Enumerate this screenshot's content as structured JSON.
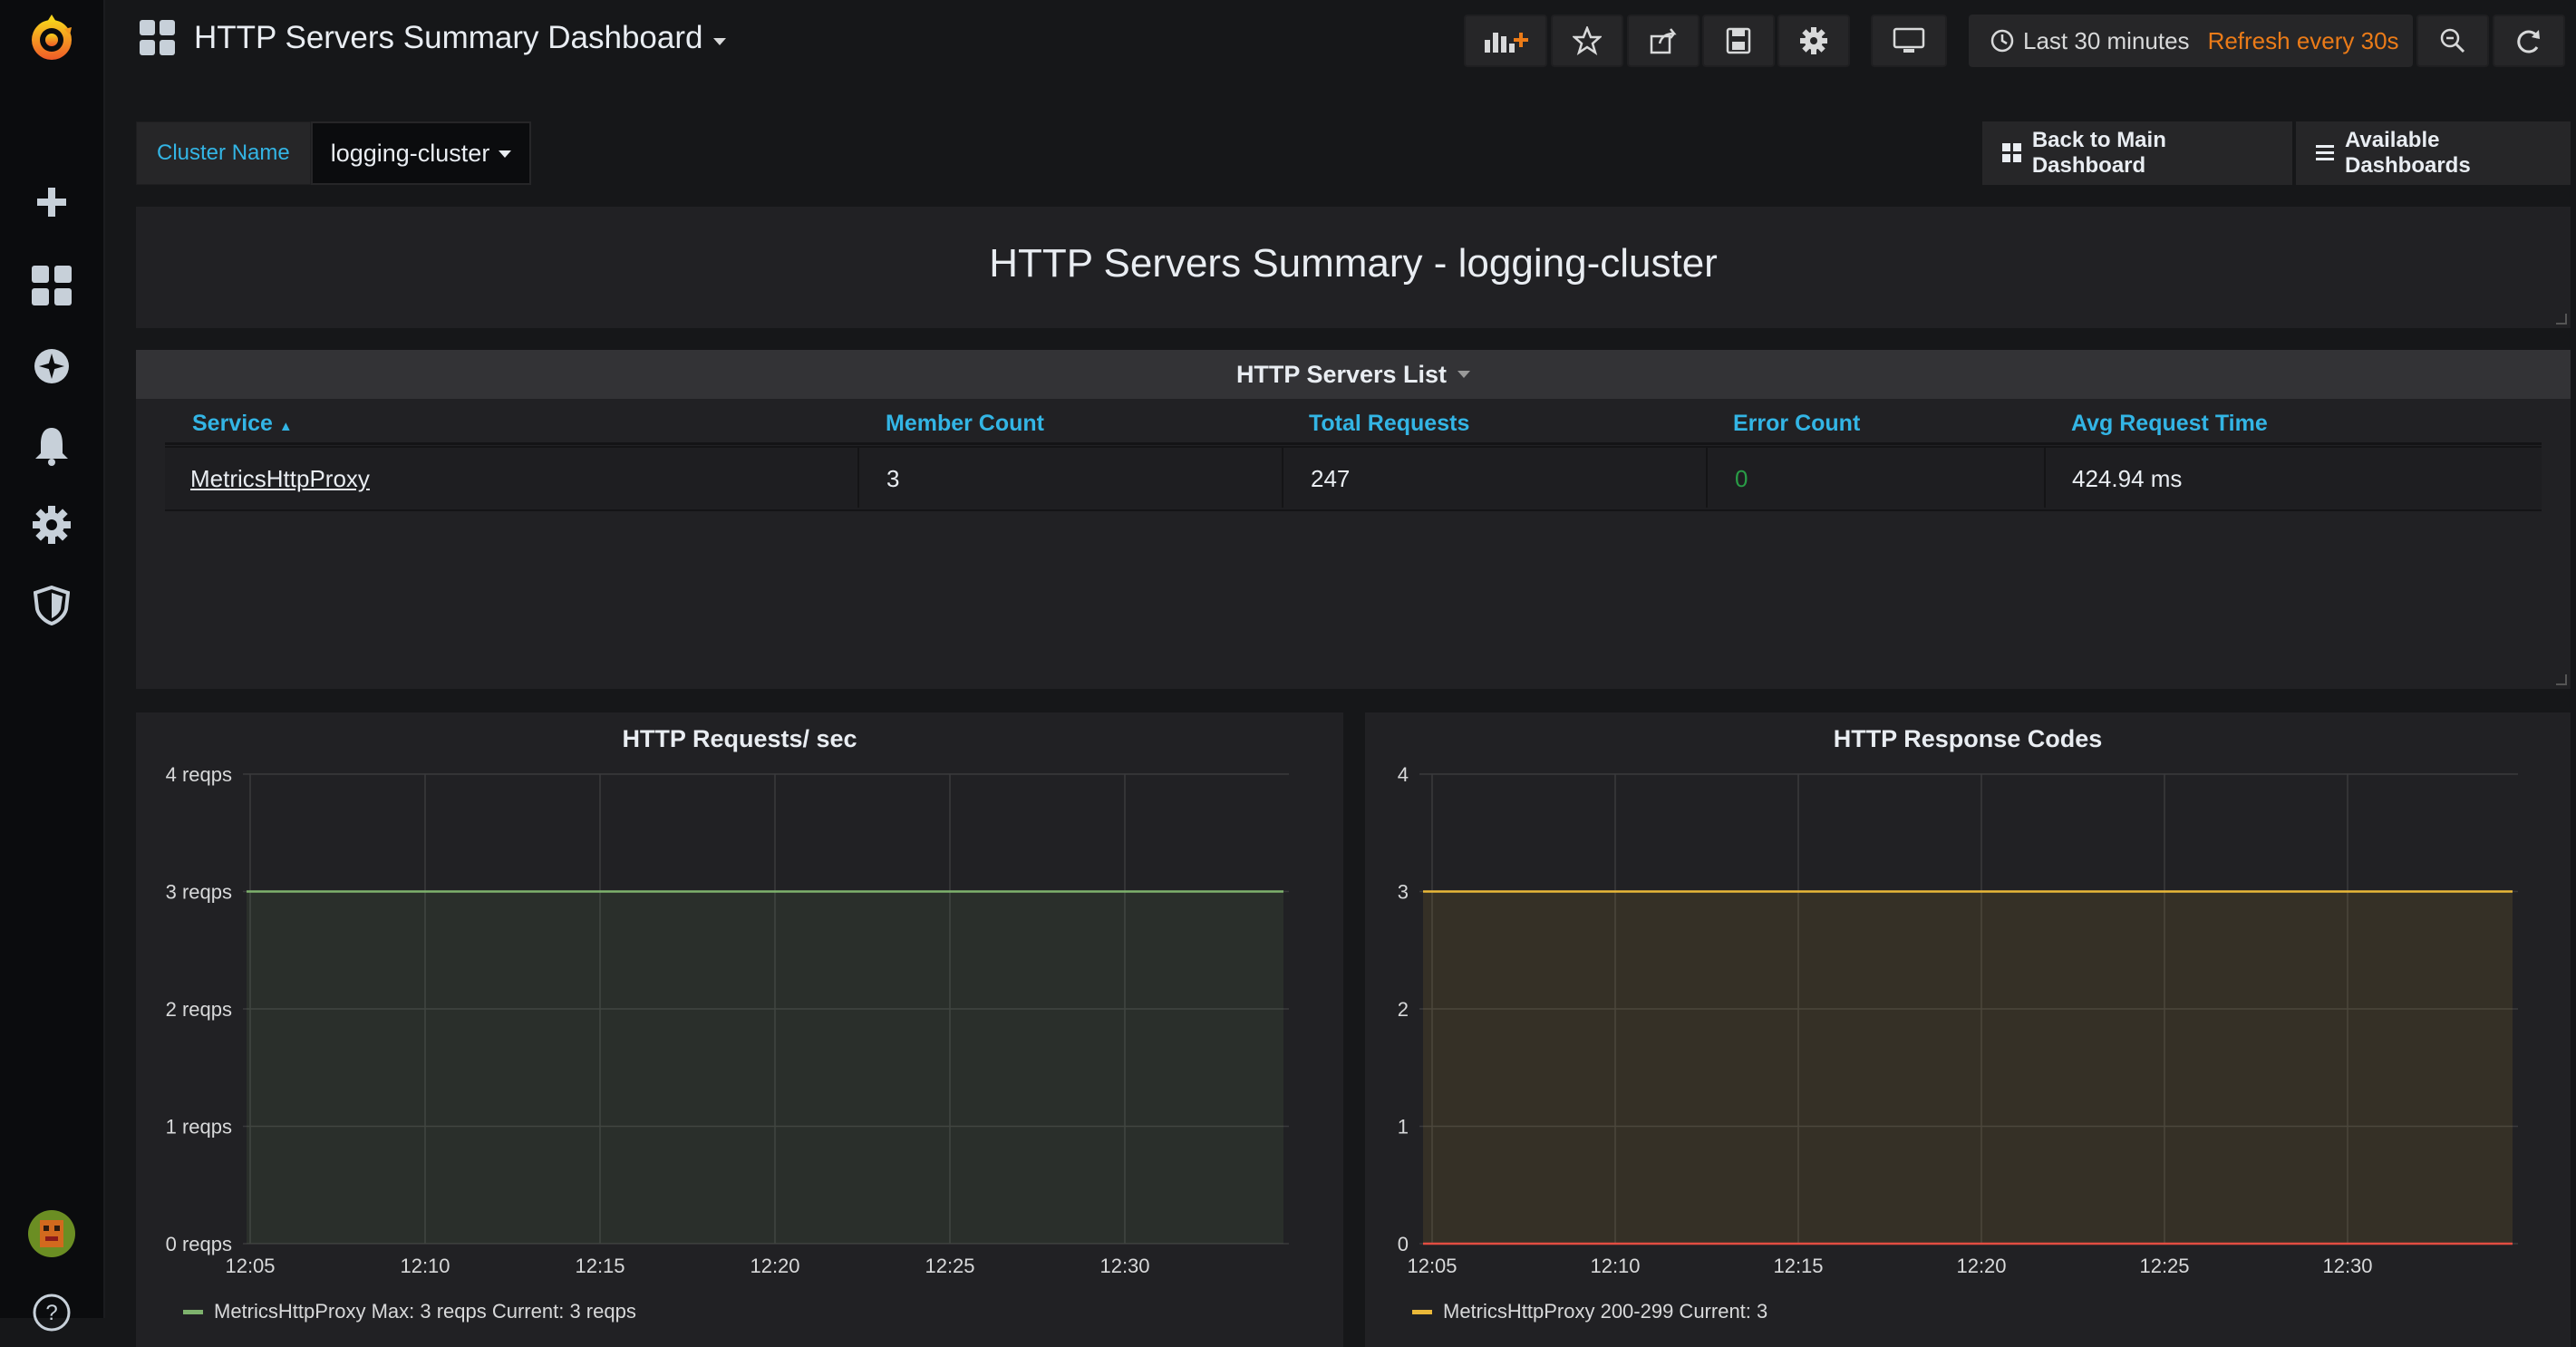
{
  "dashboard": {
    "title": "HTTP Servers Summary Dashboard"
  },
  "time_picker": {
    "range": "Last 30 minutes",
    "refresh": "Refresh every 30s"
  },
  "variables": {
    "cluster_label": "Cluster Name",
    "cluster_value": "logging-cluster"
  },
  "links": {
    "back": "Back to Main Dashboard",
    "available": "Available Dashboards"
  },
  "text_panel": {
    "title": "HTTP Servers Summary - logging-cluster"
  },
  "table": {
    "title": "HTTP Servers List",
    "columns": [
      "Service",
      "Member Count",
      "Total Requests",
      "Error Count",
      "Avg Request Time"
    ],
    "rows": [
      {
        "service": "MetricsHttpProxy",
        "member_count": "3",
        "total_requests": "247",
        "error_count": "0",
        "avg_request_time": "424.94 ms"
      }
    ]
  },
  "chart_data": [
    {
      "type": "area",
      "title": "HTTP Requests/ sec",
      "x": [
        "12:05",
        "12:10",
        "12:15",
        "12:20",
        "12:25",
        "12:30"
      ],
      "y_ticks": [
        "0 reqps",
        "1 reqps",
        "2 reqps",
        "3 reqps",
        "4 reqps"
      ],
      "ylim": [
        0,
        4
      ],
      "series": [
        {
          "name": "MetricsHttpProxy",
          "color": "#7eb26d",
          "values": [
            3,
            3,
            3,
            3,
            3,
            3
          ]
        }
      ],
      "legend": "MetricsHttpProxy  Max: 3 reqps  Current: 3 reqps",
      "grid": true
    },
    {
      "type": "area",
      "title": "HTTP Response Codes",
      "x": [
        "12:05",
        "12:10",
        "12:15",
        "12:20",
        "12:25",
        "12:30"
      ],
      "y_ticks": [
        "0",
        "1",
        "2",
        "3",
        "4"
      ],
      "ylim": [
        0,
        4
      ],
      "series": [
        {
          "name": "MetricsHttpProxy 200-299",
          "color": "#eab839",
          "values": [
            3,
            3,
            3,
            3,
            3,
            3
          ]
        },
        {
          "name": "",
          "color": "#e24d42",
          "values": [
            0,
            0,
            0,
            0,
            0,
            0
          ]
        }
      ],
      "legend": "MetricsHttpProxy 200-299  Current: 3",
      "grid": true
    }
  ],
  "colors": {
    "accent": "#33b5e5",
    "orange": "#eb7b18",
    "ok": "#299c46"
  },
  "icons": [
    "grafana-logo-icon",
    "plus-icon",
    "dashboards-icon",
    "explore-icon",
    "bell-icon",
    "gear-icon",
    "shield-icon",
    "user-avatar",
    "help-icon",
    "add-panel-icon",
    "star-icon",
    "share-icon",
    "save-icon",
    "settings-icon",
    "tv-icon",
    "clock-icon",
    "zoom-out-icon",
    "refresh-icon"
  ]
}
